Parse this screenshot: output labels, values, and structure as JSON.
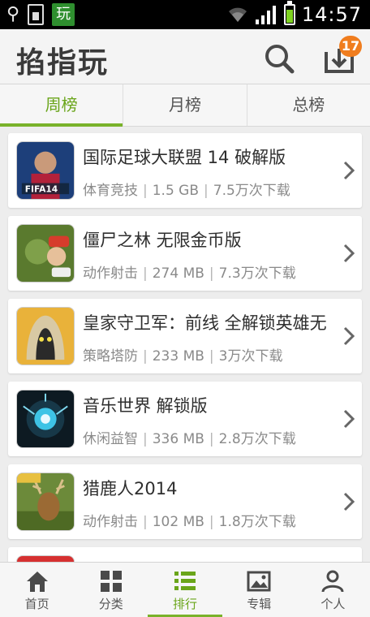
{
  "status_bar": {
    "app_badge": "玩",
    "time": "14:57",
    "icons": [
      "usb-icon",
      "sim-icon",
      "app-badge-icon",
      "wifi-icon",
      "signal-icon",
      "battery-charging-icon"
    ]
  },
  "header": {
    "title": "掐指玩",
    "download_badge": "17",
    "icons": [
      "search-icon",
      "download-icon"
    ]
  },
  "tabs": [
    {
      "label": "周榜",
      "active": true
    },
    {
      "label": "月榜",
      "active": false
    },
    {
      "label": "总榜",
      "active": false
    }
  ],
  "apps": [
    {
      "name": "国际足球大联盟 14 破解版",
      "category": "体育竞技",
      "size": "1.5 GB",
      "downloads": "7.5万次下载",
      "icon": "fifa14-game-icon"
    },
    {
      "name": "僵尸之林 无限金币版",
      "category": "动作射击",
      "size": "274 MB",
      "downloads": "7.3万次下载",
      "icon": "zombie-forest-game-icon"
    },
    {
      "name": "皇家守卫军：前线 全解锁英雄无",
      "category": "策略塔防",
      "size": "233 MB",
      "downloads": "3万次下载",
      "icon": "kingdom-rush-game-icon"
    },
    {
      "name": "音乐世界 解锁版",
      "category": "休闲益智",
      "size": "336 MB",
      "downloads": "2.8万次下载",
      "icon": "music-world-game-icon"
    },
    {
      "name": "猎鹿人2014",
      "category": "动作射击",
      "size": "102 MB",
      "downloads": "1.8万次下载",
      "icon": "deer-hunter-game-icon"
    }
  ],
  "bottom_nav": [
    {
      "label": "首页",
      "icon": "home-icon",
      "active": false
    },
    {
      "label": "分类",
      "icon": "grid-icon",
      "active": false
    },
    {
      "label": "排行",
      "icon": "list-icon",
      "active": true
    },
    {
      "label": "专辑",
      "icon": "album-icon",
      "active": false
    },
    {
      "label": "个人",
      "icon": "person-icon",
      "active": false
    }
  ],
  "colors": {
    "accent": "#79b22a",
    "badge": "#f07d1e",
    "status_bar": "#000000"
  }
}
